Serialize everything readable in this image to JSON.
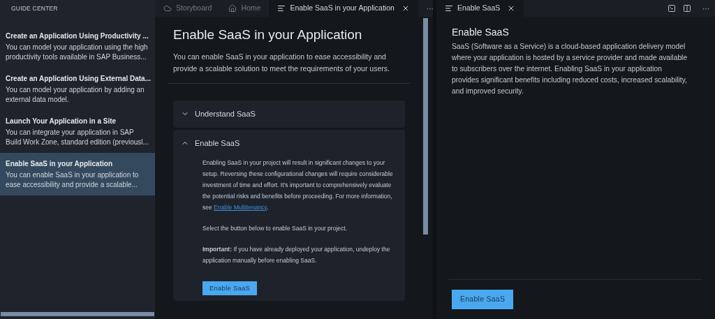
{
  "sidebar": {
    "title": "GUIDE CENTER",
    "items": [
      {
        "title": "Create an Application Using Productivity ...",
        "description": "You can model your application using the high productivity tools available in SAP Business...",
        "selected": false
      },
      {
        "title": "Create an Application Using External Data...",
        "description": "You can model your application by adding an external data model.",
        "selected": false
      },
      {
        "title": "Launch Your Application in a Site",
        "description": "You can integrate your application in SAP Build Work Zone, standard edition (previousl...",
        "selected": false
      },
      {
        "title": "Enable SaaS in your Application",
        "description": "You can enable SaaS in your application to ease accessibility and provide a scalable...",
        "selected": true
      }
    ]
  },
  "editor": {
    "tabs": [
      {
        "label": "Storyboard",
        "kind": "cloud",
        "selected": false,
        "closable": false
      },
      {
        "label": "Home",
        "kind": "home",
        "selected": false,
        "closable": false
      },
      {
        "label": "Enable SaaS in your Application",
        "kind": "doc",
        "selected": true,
        "closable": true
      }
    ],
    "more": "···",
    "title": "Enable SaaS in your Application",
    "intro": "You can enable SaaS in your application to ease accessibility and provide a scalable solution to meet the requirements of your users.",
    "sections": [
      {
        "heading": "Understand SaaS",
        "expanded": false
      },
      {
        "heading": "Enable SaaS",
        "expanded": true,
        "body": [
          {
            "kind": "link_text",
            "before": "Enabling SaaS in your project will result in significant changes to your setup. Reversing these configurational changes will require considerable investment of time and effort. It’s important to comprehensively evaluate the potential risks and benefits before proceeding. For more information, see ",
            "link": "Enable Multitenancy",
            "after": "."
          },
          {
            "kind": "text",
            "text": "Select the button below to enable SaaS in your project."
          },
          {
            "kind": "text",
            "text": "**Important:** If you have already deployed your application, undeploy the application manually before enabling SaaS."
          }
        ],
        "button": "Enable SaaS"
      }
    ]
  },
  "panel": {
    "tabs": [
      {
        "label": "Enable SaaS",
        "kind": "doc",
        "selected": true,
        "closable": true
      }
    ],
    "more": "···",
    "title": "Enable SaaS",
    "text": "SaaS (Software as a Service) is a cloud-based application delivery model where your application is hosted by a service provider and made available to subscribers over the internet. Enabling SaaS in your application provides significant benefits including reduced costs, increased scalability, and improved security.",
    "button": "Enable SaaS"
  }
}
